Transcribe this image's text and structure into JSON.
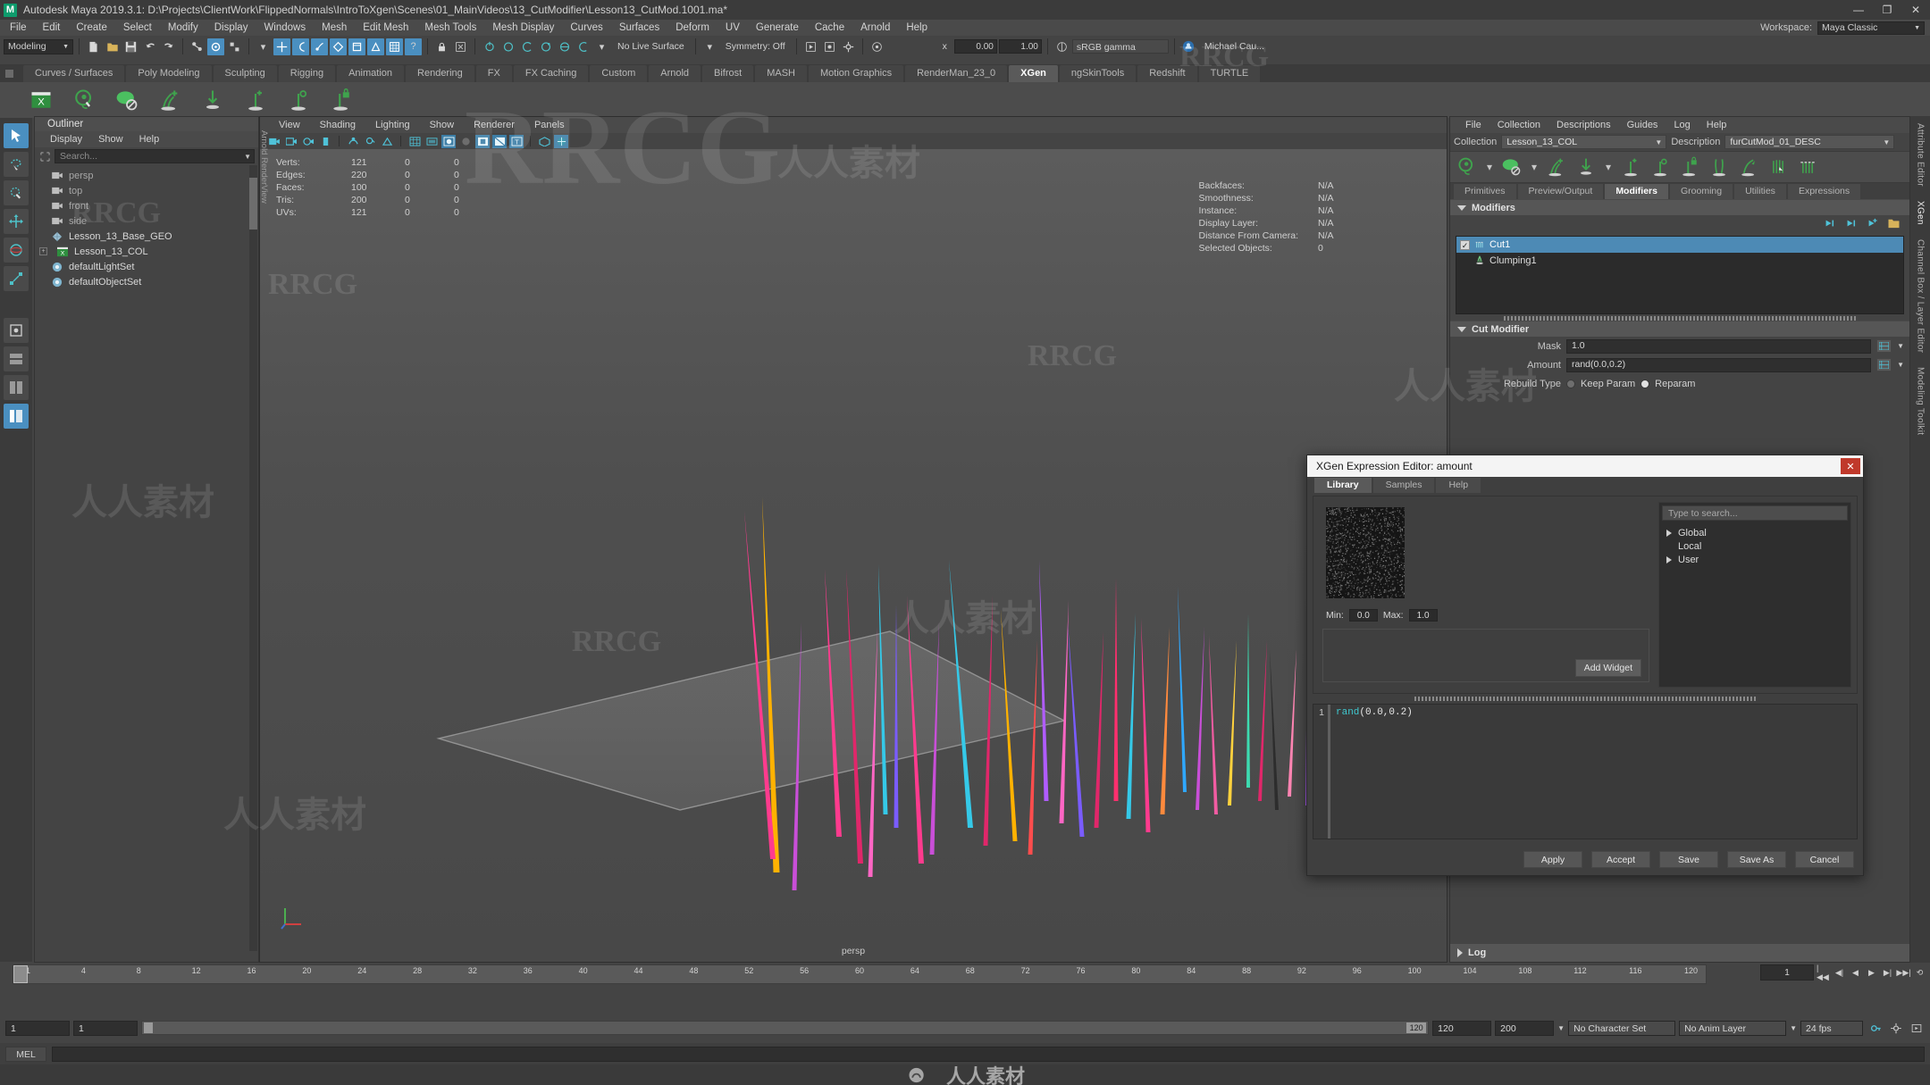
{
  "titlebar": {
    "app_title": "Autodesk Maya 2019.3.1: D:\\Projects\\ClientWork\\FlippedNormals\\IntroToXgen\\Scenes\\01_MainVideos\\13_CutModifier\\Lesson13_CutMod.1001.ma*",
    "logo": "M",
    "minimize": "—",
    "maximize": "❐",
    "close": "✕"
  },
  "menubar": {
    "items": [
      "File",
      "Edit",
      "Create",
      "Select",
      "Modify",
      "Display",
      "Windows",
      "Mesh",
      "Edit Mesh",
      "Mesh Tools",
      "Mesh Display",
      "Curves",
      "Surfaces",
      "Deform",
      "UV",
      "Generate",
      "Cache",
      "Arnold",
      "Help"
    ],
    "workspace_label": "Workspace:",
    "workspace_value": "Maya Classic"
  },
  "toolbar": {
    "menuset": "Modeling",
    "live_surface": "No Live Surface",
    "symmetry": "Symmetry: Off",
    "num1": "0.00",
    "num2": "1.00",
    "colorspace": "sRGB gamma",
    "user": "Michael Cau...",
    "x_label": "x"
  },
  "shelf": {
    "tabs": [
      "Curves / Surfaces",
      "Poly Modeling",
      "Sculpting",
      "Rigging",
      "Animation",
      "Rendering",
      "FX",
      "FX Caching",
      "Custom",
      "Arnold",
      "Bifrost",
      "MASH",
      "Motion Graphics",
      "RenderMan_23_0",
      "XGen",
      "ngSkinTools",
      "Redshift",
      "TURTLE"
    ],
    "active_tab": "XGen"
  },
  "outliner": {
    "title": "Outliner",
    "menu": [
      "Display",
      "Show",
      "Help"
    ],
    "search_placeholder": "Search...",
    "items": [
      {
        "label": "persp",
        "icon": "camera-icon",
        "dim": true
      },
      {
        "label": "top",
        "icon": "camera-icon",
        "dim": true
      },
      {
        "label": "front",
        "icon": "camera-icon",
        "dim": true
      },
      {
        "label": "side",
        "icon": "camera-icon",
        "dim": true
      },
      {
        "label": "Lesson_13_Base_GEO",
        "icon": "mesh-icon",
        "dim": false
      },
      {
        "label": "Lesson_13_COL",
        "icon": "xgen-collection-icon",
        "dim": false,
        "expandable": true
      },
      {
        "label": "defaultLightSet",
        "icon": "set-icon",
        "dim": false
      },
      {
        "label": "defaultObjectSet",
        "icon": "set-icon",
        "dim": false
      }
    ]
  },
  "viewport": {
    "menu": [
      "View",
      "Shading",
      "Lighting",
      "Show",
      "Renderer",
      "Panels"
    ],
    "camera_label": "persp",
    "side_rail_label": "Arnold RenderView",
    "hud_left": {
      "rows": [
        {
          "label": "Verts:",
          "v1": "121",
          "v2": "0",
          "v3": "0"
        },
        {
          "label": "Edges:",
          "v1": "220",
          "v2": "0",
          "v3": "0"
        },
        {
          "label": "Faces:",
          "v1": "100",
          "v2": "0",
          "v3": "0"
        },
        {
          "label": "Tris:",
          "v1": "200",
          "v2": "0",
          "v3": "0"
        },
        {
          "label": "UVs:",
          "v1": "121",
          "v2": "0",
          "v3": "0"
        }
      ]
    },
    "hud_right": {
      "rows": [
        {
          "label": "Backfaces:",
          "value": "N/A"
        },
        {
          "label": "Smoothness:",
          "value": "N/A"
        },
        {
          "label": "Instance:",
          "value": "N/A"
        },
        {
          "label": "Display Layer:",
          "value": "N/A"
        },
        {
          "label": "Distance From Camera:",
          "value": "N/A"
        },
        {
          "label": "Selected Objects:",
          "value": "0"
        }
      ]
    }
  },
  "xgen": {
    "menu": [
      "File",
      "Collection",
      "Descriptions",
      "Guides",
      "Log",
      "Help"
    ],
    "collection_label": "Collection",
    "collection_value": "Lesson_13_COL",
    "description_label": "Description",
    "description_value": "furCutMod_01_DESC",
    "tabs": [
      "Primitives",
      "Preview/Output",
      "Modifiers",
      "Grooming",
      "Utilities",
      "Expressions"
    ],
    "active_tab": "Modifiers",
    "modifiers_section": "Modifiers",
    "modifier_list": [
      {
        "name": "Cut1",
        "checked": true,
        "selected": true
      },
      {
        "name": "Clumping1",
        "checked": false,
        "selected": false
      }
    ],
    "cut_section": "Cut Modifier",
    "mask_label": "Mask",
    "mask_value": "1.0",
    "amount_label": "Amount",
    "amount_value": "rand(0.0,0.2)",
    "rebuild_label": "Rebuild Type",
    "rebuild_options": [
      "Keep Param",
      "Reparam"
    ],
    "rebuild_selected": "Reparam",
    "log_label": "Log"
  },
  "right_rail": {
    "tabs": [
      "Attribute Editor",
      "XGen",
      "Channel Box / Layer Editor",
      "Modeling Toolkit"
    ]
  },
  "dialog": {
    "title": "XGen Expression Editor: amount",
    "close": "✕",
    "tabs": [
      "Library",
      "Samples",
      "Help"
    ],
    "active_tab": "Library",
    "min_label": "Min:",
    "min_value": "0.0",
    "max_label": "Max:",
    "max_value": "1.0",
    "add_widget": "Add Widget",
    "search_placeholder": "Type to search...",
    "tree": [
      {
        "label": "Global",
        "has_children": true
      },
      {
        "label": "Local",
        "has_children": false
      },
      {
        "label": "User",
        "has_children": true
      }
    ],
    "code_line_number": "1",
    "code_keyword": "rand",
    "code_args": "(0.0,0.2)",
    "buttons": [
      "Apply",
      "Accept",
      "Save",
      "Save As",
      "Cancel"
    ]
  },
  "timeline": {
    "ticks": [
      "1",
      "4",
      "8",
      "12",
      "16",
      "20",
      "24",
      "28",
      "32",
      "36",
      "40",
      "44",
      "48",
      "52",
      "56",
      "60",
      "64",
      "68",
      "72",
      "76",
      "80",
      "84",
      "88",
      "92",
      "96",
      "100",
      "104",
      "108",
      "112",
      "116",
      "120"
    ],
    "current_frame": "1",
    "current_field": "1",
    "playback_icons": [
      "|◀◀",
      "◀|",
      "◀",
      "▶",
      "▶|",
      "▶▶|",
      "⟲"
    ]
  },
  "rangebar": {
    "start": "1",
    "start2": "1",
    "range_start": "1",
    "range_handle_label": "120",
    "anim_start": "120",
    "anim_end": "200",
    "character_set": "No Character Set",
    "anim_layer": "No Anim Layer",
    "fps": "24 fps"
  },
  "statusbar": {
    "script_type": "MEL",
    "command": ""
  },
  "watermarks": {
    "cn": "人人素材",
    "rr": "RRCG",
    "big_rr": "RRCG"
  },
  "colors": {
    "accent_blue": "#4d8ab5",
    "xgen_green": "#3fa34d",
    "close_red": "#c0392b",
    "panel_bg": "#444444",
    "title_bg": "#3b3b3b",
    "code_keyword": "#3fc8cf"
  },
  "chart_data": {
    "type": "scatter",
    "title": "XGen hair primitives viewport render",
    "note": "Colored tapered hair strands standing on a ground plane"
  }
}
